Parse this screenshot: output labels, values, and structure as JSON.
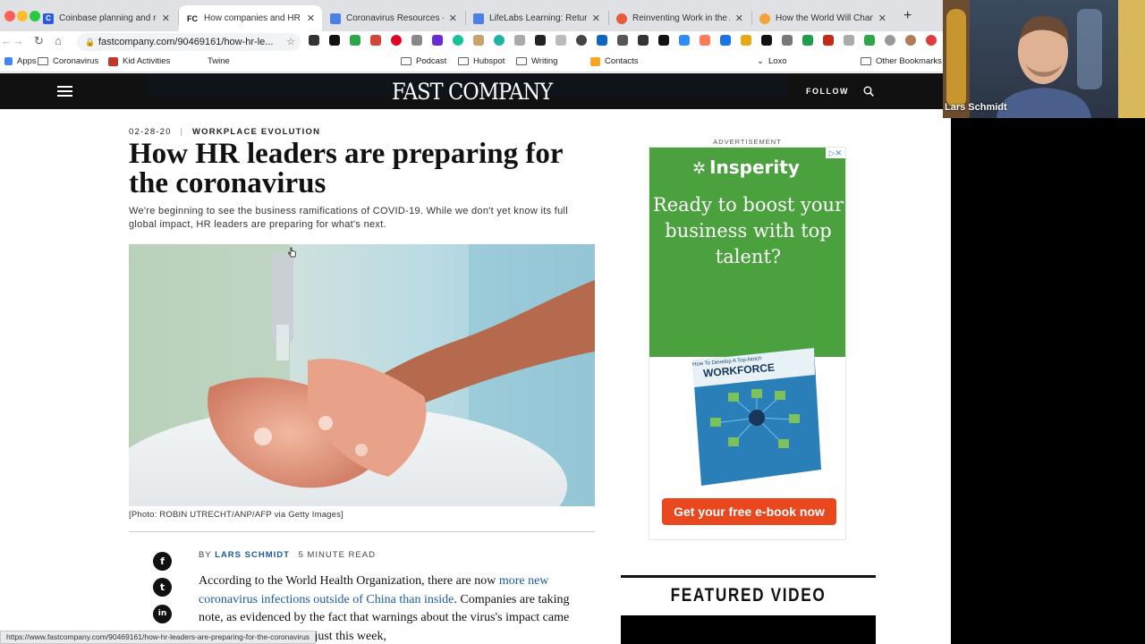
{
  "browser": {
    "tabs": [
      {
        "label": "Coinbase planning and res",
        "favicon_text": "C",
        "favicon_color": "#2c5be0",
        "active": false
      },
      {
        "label": "How companies and HR le",
        "favicon_text": "FC",
        "favicon_color": "#111111",
        "active": true
      },
      {
        "label": "Coronavirus Resources - G",
        "favicon_text": "",
        "favicon_color": "#4a7fe3",
        "active": false
      },
      {
        "label": "LifeLabs Learning: Return",
        "favicon_text": "",
        "favicon_color": "#4a7fe3",
        "active": false
      },
      {
        "label": "Reinventing Work in the Ag",
        "favicon_text": "",
        "favicon_color": "#e95a3c",
        "active": false
      },
      {
        "label": "How the World Will Change",
        "favicon_text": "",
        "favicon_color": "#f2a33a",
        "active": false
      }
    ],
    "new_tab_symbol": "+",
    "url": "fastcompany.com/90469161/how-hr-le...",
    "bookmarks": {
      "apps": "Apps",
      "coronavirus": "Coronavirus",
      "kid_activities": "Kid Activities",
      "twine": "Twine",
      "podcast": "Podcast",
      "hubspot": "Hubspot",
      "writing": "Writing",
      "contacts": "Contacts",
      "loxo": "Loxo",
      "other": "Other Bookmarks"
    },
    "status_url": "https://www.fastcompany.com/90469161/how-hr-leaders-are-preparing-for-the-coronavirus"
  },
  "site": {
    "logo": "FAST COMPANY",
    "follow_label": "FOLLOW"
  },
  "article": {
    "date": "02-28-20",
    "separator": "|",
    "section": "WORKPLACE EVOLUTION",
    "title": "How HR leaders are preparing for the coronavirus",
    "dek": "We're beginning to see the business ramifications of COVID-19. While we don't yet know its full global impact, HR leaders are preparing for what's next.",
    "caption": "[Photo: ROBIN UTRECHT/ANP/AFP via Getty Images]",
    "byline_prefix": "BY ",
    "author": "LARS SCHMIDT",
    "read_time": "5 MINUTE READ",
    "body_1": "According to the World Health Organization, there are now ",
    "body_link": "more new coronavirus infections outside of China than inside",
    "body_2": ". Companies are taking note, as evidenced by the fact that warnings about the virus's impact came up in 27 earnings calls just this week,",
    "social": {
      "facebook": "f",
      "twitter": "t",
      "linkedin": "in"
    }
  },
  "ad": {
    "label": "ADVERTISEMENT",
    "brand": "Insperity",
    "headline": "Ready to boost your business with top talent?",
    "book_title": "WORKFORCE",
    "book_subtitle": "How To Develop A Top-Notch",
    "cta": "Get your free e-book now"
  },
  "featured": {
    "title": "FEATURED VIDEO"
  },
  "webcam": {
    "name": "Lars Schmidt"
  }
}
